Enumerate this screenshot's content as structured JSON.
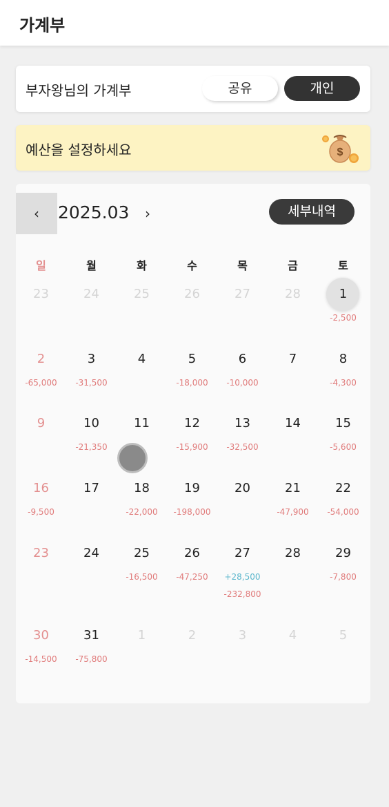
{
  "app": {
    "title": "가계부"
  },
  "book": {
    "name": "부자왕님의 가계부",
    "share_label": "공유",
    "personal_label": "개인"
  },
  "budget": {
    "prompt": "예산을 설정하세요",
    "icon": "money-bag-icon"
  },
  "calendar": {
    "prev_label": "‹",
    "month": "2025.03",
    "next_label": "›",
    "detail_label": "세부내역",
    "weekdays": [
      "일",
      "월",
      "화",
      "수",
      "목",
      "금",
      "토"
    ],
    "weeks": [
      [
        {
          "d": "23",
          "other": true,
          "amounts": []
        },
        {
          "d": "24",
          "other": true,
          "amounts": []
        },
        {
          "d": "25",
          "other": true,
          "amounts": []
        },
        {
          "d": "26",
          "other": true,
          "amounts": []
        },
        {
          "d": "27",
          "other": true,
          "amounts": []
        },
        {
          "d": "28",
          "other": true,
          "amounts": []
        },
        {
          "d": "1",
          "amounts": [
            "-2,500"
          ],
          "selected": true
        }
      ],
      [
        {
          "d": "2",
          "amounts": [
            "-65,000"
          ]
        },
        {
          "d": "3",
          "amounts": [
            "-31,500"
          ]
        },
        {
          "d": "4",
          "amounts": []
        },
        {
          "d": "5",
          "amounts": [
            "-18,000"
          ]
        },
        {
          "d": "6",
          "amounts": [
            "-10,000"
          ]
        },
        {
          "d": "7",
          "amounts": []
        },
        {
          "d": "8",
          "amounts": [
            "-4,300"
          ]
        }
      ],
      [
        {
          "d": "9",
          "amounts": []
        },
        {
          "d": "10",
          "amounts": [
            "-21,350"
          ]
        },
        {
          "d": "11",
          "amounts": []
        },
        {
          "d": "12",
          "amounts": [
            "-15,900"
          ]
        },
        {
          "d": "13",
          "amounts": [
            "-32,500"
          ]
        },
        {
          "d": "14",
          "amounts": []
        },
        {
          "d": "15",
          "amounts": [
            "-5,600"
          ]
        }
      ],
      [
        {
          "d": "16",
          "amounts": [
            "-9,500"
          ]
        },
        {
          "d": "17",
          "amounts": []
        },
        {
          "d": "18",
          "amounts": [
            "-22,000"
          ]
        },
        {
          "d": "19",
          "amounts": [
            "-198,000"
          ]
        },
        {
          "d": "20",
          "amounts": []
        },
        {
          "d": "21",
          "amounts": [
            "-47,900"
          ]
        },
        {
          "d": "22",
          "amounts": [
            "-54,000"
          ]
        }
      ],
      [
        {
          "d": "23",
          "amounts": []
        },
        {
          "d": "24",
          "amounts": []
        },
        {
          "d": "25",
          "amounts": [
            "-16,500"
          ]
        },
        {
          "d": "26",
          "amounts": [
            "-47,250"
          ]
        },
        {
          "d": "27",
          "amounts": [
            "+28,500",
            "-232,800"
          ]
        },
        {
          "d": "28",
          "amounts": []
        },
        {
          "d": "29",
          "amounts": [
            "-7,800"
          ]
        }
      ],
      [
        {
          "d": "30",
          "amounts": [
            "-14,500"
          ]
        },
        {
          "d": "31",
          "amounts": [
            "-75,800"
          ]
        },
        {
          "d": "1",
          "other": true,
          "amounts": []
        },
        {
          "d": "2",
          "other": true,
          "amounts": []
        },
        {
          "d": "3",
          "other": true,
          "amounts": []
        },
        {
          "d": "4",
          "other": true,
          "amounts": []
        },
        {
          "d": "5",
          "other": true,
          "amounts": []
        }
      ]
    ]
  },
  "colors": {
    "sunday": "#e38f8f",
    "expense": "#e07a7a",
    "income": "#5bb6cc",
    "budget_bg": "#fdf3c3",
    "dark_button": "#333333"
  }
}
